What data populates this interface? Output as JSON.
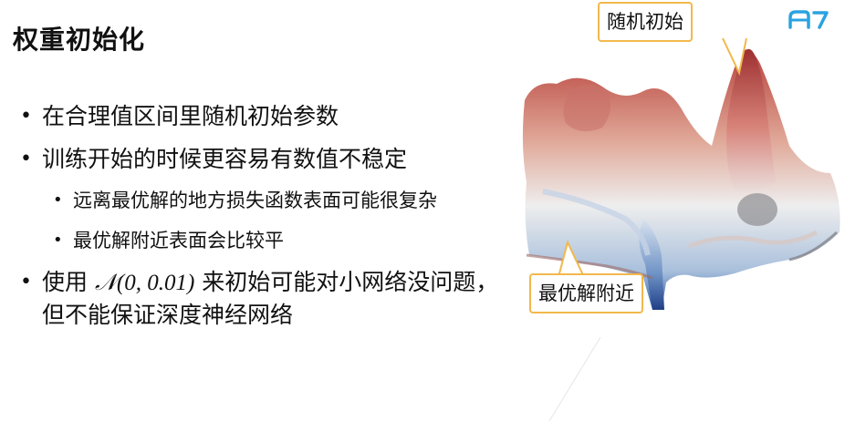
{
  "slide": {
    "title": "权重初始化",
    "bullets": [
      {
        "text": "在合理值区间里随机初始参数"
      },
      {
        "text": "训练开始的时候更容易有数值不稳定"
      }
    ],
    "sub_bullets": [
      {
        "text": "远离最优解的地方损失函数表面可能很复杂"
      },
      {
        "text": "最优解附近表面会比较平"
      }
    ],
    "last_bullet": {
      "pre": "使用",
      "math": "𝒩(0, 0.01)",
      "post": "来初始可能对小网络没问题，但不能保证深度神经网络"
    },
    "bullet_symbol": "•"
  },
  "figure": {
    "callout_top": "随机初始",
    "callout_bottom": "最优解附近",
    "colors": {
      "callout_border": "#f2b84b",
      "surface_high": "#b8423c",
      "surface_low": "#2b5ca8",
      "logo": "#2aa3e0"
    }
  },
  "logo": {
    "icon": "a-logo-icon"
  }
}
